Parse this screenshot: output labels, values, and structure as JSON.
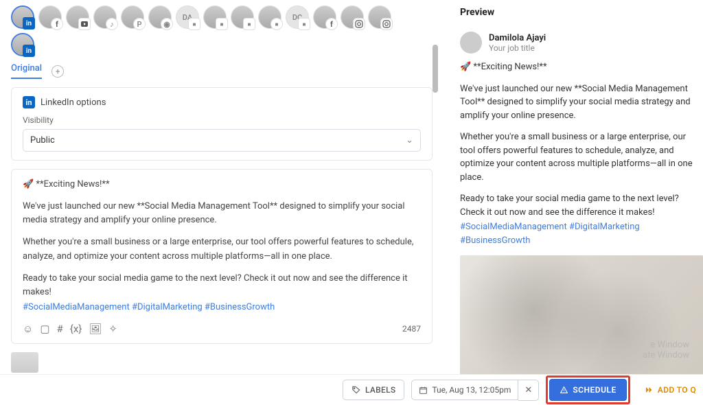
{
  "accounts": {
    "row1": [
      {
        "id": "a1",
        "label": "",
        "badge": "linkedin",
        "selected": true
      },
      {
        "id": "a2",
        "label": "",
        "badge": "fb"
      },
      {
        "id": "a3",
        "label": "",
        "badge": "yt"
      },
      {
        "id": "a4",
        "label": "",
        "badge": "tt"
      },
      {
        "id": "a5",
        "label": "",
        "badge": "pin"
      },
      {
        "id": "a6",
        "label": "",
        "badge": "rd"
      },
      {
        "id": "a7",
        "label": "DA",
        "badge": "sq"
      },
      {
        "id": "a8",
        "label": "",
        "badge": "sq"
      },
      {
        "id": "a9",
        "label": "",
        "badge": "tb"
      },
      {
        "id": "a10",
        "label": "",
        "badge": "bf"
      },
      {
        "id": "a11",
        "label": "DC",
        "badge": "sq"
      },
      {
        "id": "a12",
        "label": "",
        "badge": "fb"
      },
      {
        "id": "a13",
        "label": "",
        "badge": "ig"
      },
      {
        "id": "a14",
        "label": "",
        "badge": "ig"
      }
    ],
    "row2": [
      {
        "id": "a15",
        "label": "",
        "badge": "linkedin",
        "selected": true
      }
    ]
  },
  "tabs": {
    "active": "Original"
  },
  "linkedinOptions": {
    "title": "LinkedIn options",
    "visibilityLabel": "Visibility",
    "visibilityValue": "Public"
  },
  "post": {
    "headline": "🚀 **Exciting News!**",
    "p1": "We've just launched our new **Social Media Management Tool** designed to simplify your social media strategy and amplify your online presence.",
    "p2": "Whether you're a small business or a large enterprise, our tool offers powerful features to schedule, analyze, and optimize your content across multiple platforms—all in one place.",
    "p3": "Ready to take your social media game to the next level? Check it out now and see the difference it makes!",
    "hashtags": "#SocialMediaManagement #DigitalMarketing #BusinessGrowth",
    "charCount": "2487"
  },
  "preview": {
    "title": "Preview",
    "name": "Damilola Ajayi",
    "subtitle": "Your job title",
    "headline": "🚀 **Exciting News!**",
    "p1": "We've just launched our new **Social Media Management Tool** designed to simplify your social media strategy and amplify your online presence.",
    "p2": "Whether you're a small business or a large enterprise, our tool offers powerful features to schedule, analyze, and optimize your content across multiple platforms—all in one place.",
    "p3": "Ready to take your social media game to the next level? Check it out now and see the difference it makes!",
    "hashtags": "#SocialMediaManagement #DigitalMarketing #BusinessGrowth"
  },
  "bottomBar": {
    "labels": "LABELS",
    "date": "Tue, Aug 13, 12:05pm",
    "schedule": "SCHEDULE",
    "addToQ": "ADD TO Q"
  },
  "watermark": {
    "l1": "e Window",
    "l2": "ate Window"
  },
  "icons": {
    "emoji": "☺",
    "image": "▢",
    "hash": "#",
    "var": "{x}",
    "img2": "🖼",
    "sparkle": "✧"
  }
}
